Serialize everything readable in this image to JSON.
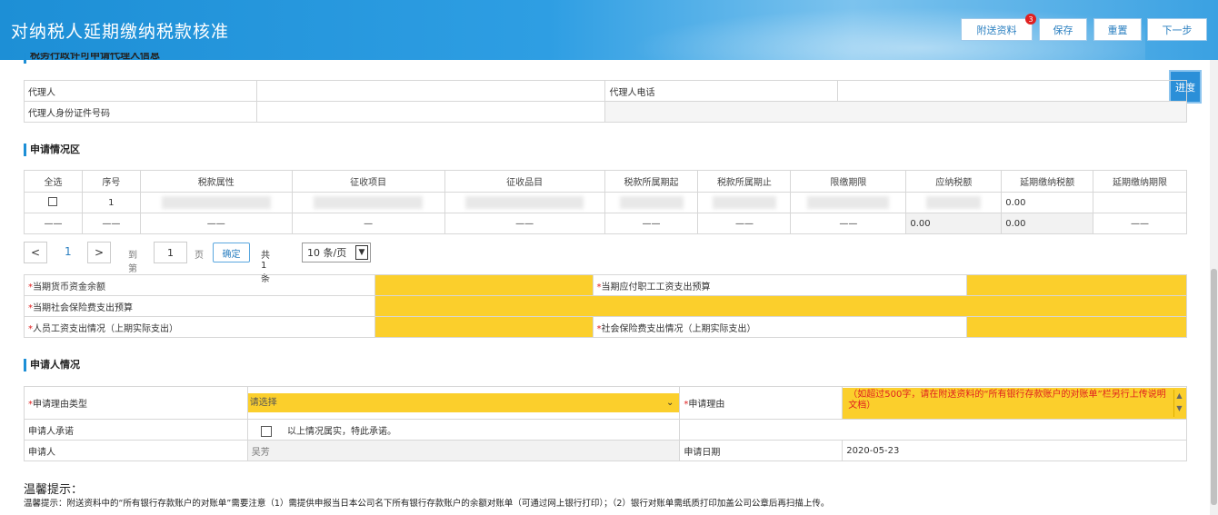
{
  "header": {
    "title": "对纳税人延期缴纳税款核准",
    "buttons": {
      "attach": "附送资料",
      "attach_badge": "3",
      "save": "保存",
      "reset": "重置",
      "next": "下一步"
    }
  },
  "progress_label": "进度",
  "agent_section": {
    "title": "税务行政许可申请代理人信息",
    "agent_label": "代理人",
    "agent_phone_label": "代理人电话",
    "agent_id_label": "代理人身份证件号码"
  },
  "application_section": {
    "title": "申请情况区",
    "columns": [
      "全选",
      "序号",
      "税款属性",
      "征收项目",
      "征收品目",
      "税款所属期起",
      "税款所属期止",
      "限缴期限",
      "应纳税额",
      "延期缴纳税额",
      "延期缴纳期限"
    ],
    "row1": {
      "index": "1",
      "deferred_amount": "0.00"
    },
    "total_row": {
      "dash": "——",
      "short_dash": "—",
      "payable": "0.00",
      "deferred": "0.00"
    }
  },
  "pager": {
    "prev": "<",
    "current": "1",
    "next": ">",
    "goto_label": "到第",
    "page_input": "1",
    "page_unit": "页",
    "confirm": "确定",
    "total": "共 1 条",
    "page_size": "10 条/页"
  },
  "financial": {
    "currency_balance": "当期货币资金余额",
    "payroll_budget": "当期应付职工工资支出预算",
    "social_insurance_budget": "当期社会保险费支出预算",
    "salary_actual": "人员工资支出情况（上期实际支出）",
    "social_actual": "社会保险费支出情况（上期实际支出）"
  },
  "applicant_section": {
    "title": "申请人情况",
    "reason_type_label": "申请理由类型",
    "reason_type_value": "请选择",
    "reason_label": "申请理由",
    "reason_placeholder": "（如超过500字，请在附送资料的“所有银行存款账户的对账单”栏另行上传说明文档）",
    "promise_label": "申请人承诺",
    "promise_text": "以上情况属实，特此承诺。",
    "applicant_label": "申请人",
    "applicant_value": "吴芳",
    "date_label": "申请日期",
    "date_value": "2020-05-23"
  },
  "tips": {
    "title": "温馨提示：",
    "text": "温馨提示：附送资料中的“所有银行存款账户的对账单”需要注意（1）需提供申报当日本公司名下所有银行存款账户的余额对账单（可通过网上银行打印）；（2）银行对账单需纸质打印加盖公司公章后再扫描上传。"
  }
}
